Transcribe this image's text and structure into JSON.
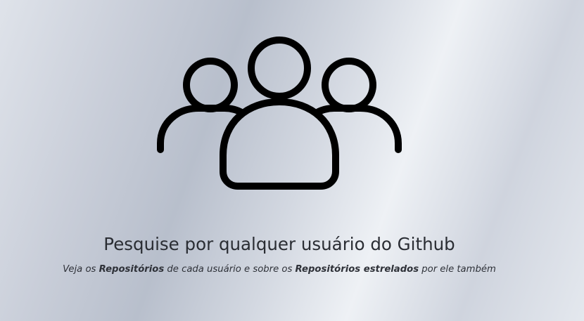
{
  "hero": {
    "icon": "users-group-icon",
    "title": "Pesquise por qualquer usuário do Github",
    "subtitle": {
      "part1": "Veja os ",
      "bold1": "Repositórios",
      "part2": " de cada usuário e sobre os ",
      "bold2": "Repositórios estrelados",
      "part3": " por ele também"
    }
  }
}
